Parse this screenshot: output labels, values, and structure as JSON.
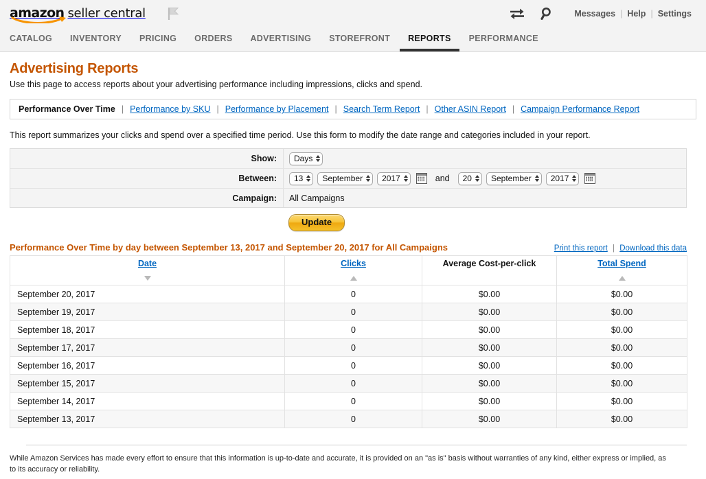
{
  "masthead": {
    "logo_amazon": "amazon",
    "logo_seller": "seller central",
    "flag_icon": "flag-icon",
    "switch_icon": "switch-accounts-icon",
    "search_icon": "search-icon",
    "links": [
      {
        "label": "Messages"
      },
      {
        "label": "Help"
      },
      {
        "label": "Settings"
      }
    ],
    "separator": "|"
  },
  "nav": {
    "items": [
      {
        "label": "CATALOG",
        "active": false
      },
      {
        "label": "INVENTORY",
        "active": false
      },
      {
        "label": "PRICING",
        "active": false
      },
      {
        "label": "ORDERS",
        "active": false
      },
      {
        "label": "ADVERTISING",
        "active": false
      },
      {
        "label": "STOREFRONT",
        "active": false
      },
      {
        "label": "REPORTS",
        "active": true
      },
      {
        "label": "PERFORMANCE",
        "active": false
      }
    ]
  },
  "page": {
    "title": "Advertising Reports",
    "subtitle": "Use this page to access reports about your advertising performance including impressions, clicks and spend.",
    "report_description": "This report summarizes your clicks and spend over a specified time period. Use this form to modify the date range and categories included in your report."
  },
  "report_tabs": {
    "current": "Performance Over Time",
    "separator": "|",
    "links": [
      {
        "label": "Performance by SKU"
      },
      {
        "label": "Performance by Placement"
      },
      {
        "label": "Search Term Report"
      },
      {
        "label": "Other ASIN Report"
      },
      {
        "label": "Campaign Performance Report"
      }
    ]
  },
  "form": {
    "show_label": "Show:",
    "show_value": "Days",
    "between_label": "Between:",
    "and_word": "and",
    "start_day": "13",
    "start_month": "September",
    "start_year": "2017",
    "end_day": "20",
    "end_month": "September",
    "end_year": "2017",
    "calendar_icon": "calendar-icon",
    "campaign_label": "Campaign:",
    "campaign_value": "All Campaigns",
    "update_label": "Update"
  },
  "results": {
    "title": "Performance Over Time by day between September 13, 2017 and September 20, 2017 for All Campaigns",
    "print_label": "Print this report",
    "download_label": "Download this data",
    "action_separator": "|"
  },
  "table": {
    "columns": [
      {
        "label": "Date",
        "link": true,
        "sort": "desc"
      },
      {
        "label": "Clicks",
        "link": true,
        "sort": "asc"
      },
      {
        "label": "Average Cost-per-click",
        "link": false,
        "sort": "none"
      },
      {
        "label": "Total Spend",
        "link": true,
        "sort": "asc"
      }
    ],
    "rows": [
      {
        "date": "September 20, 2017",
        "clicks": "0",
        "cpc": "$0.00",
        "spend": "$0.00"
      },
      {
        "date": "September 19, 2017",
        "clicks": "0",
        "cpc": "$0.00",
        "spend": "$0.00"
      },
      {
        "date": "September 18, 2017",
        "clicks": "0",
        "cpc": "$0.00",
        "spend": "$0.00"
      },
      {
        "date": "September 17, 2017",
        "clicks": "0",
        "cpc": "$0.00",
        "spend": "$0.00"
      },
      {
        "date": "September 16, 2017",
        "clicks": "0",
        "cpc": "$0.00",
        "spend": "$0.00"
      },
      {
        "date": "September 15, 2017",
        "clicks": "0",
        "cpc": "$0.00",
        "spend": "$0.00"
      },
      {
        "date": "September 14, 2017",
        "clicks": "0",
        "cpc": "$0.00",
        "spend": "$0.00"
      },
      {
        "date": "September 13, 2017",
        "clicks": "0",
        "cpc": "$0.00",
        "spend": "$0.00"
      }
    ]
  },
  "footer": {
    "disclaimer": "While Amazon Services has made every effort to ensure that this information is up-to-date and accurate, it is provided on an \"as is\" basis without warranties of any kind, either express or implied, as to its accuracy or reliability."
  },
  "colors": {
    "brand_orange": "#c45500",
    "link_blue": "#0066c0",
    "nav_bg": "#f3f3f3",
    "button_gold": "#f7c53a"
  }
}
